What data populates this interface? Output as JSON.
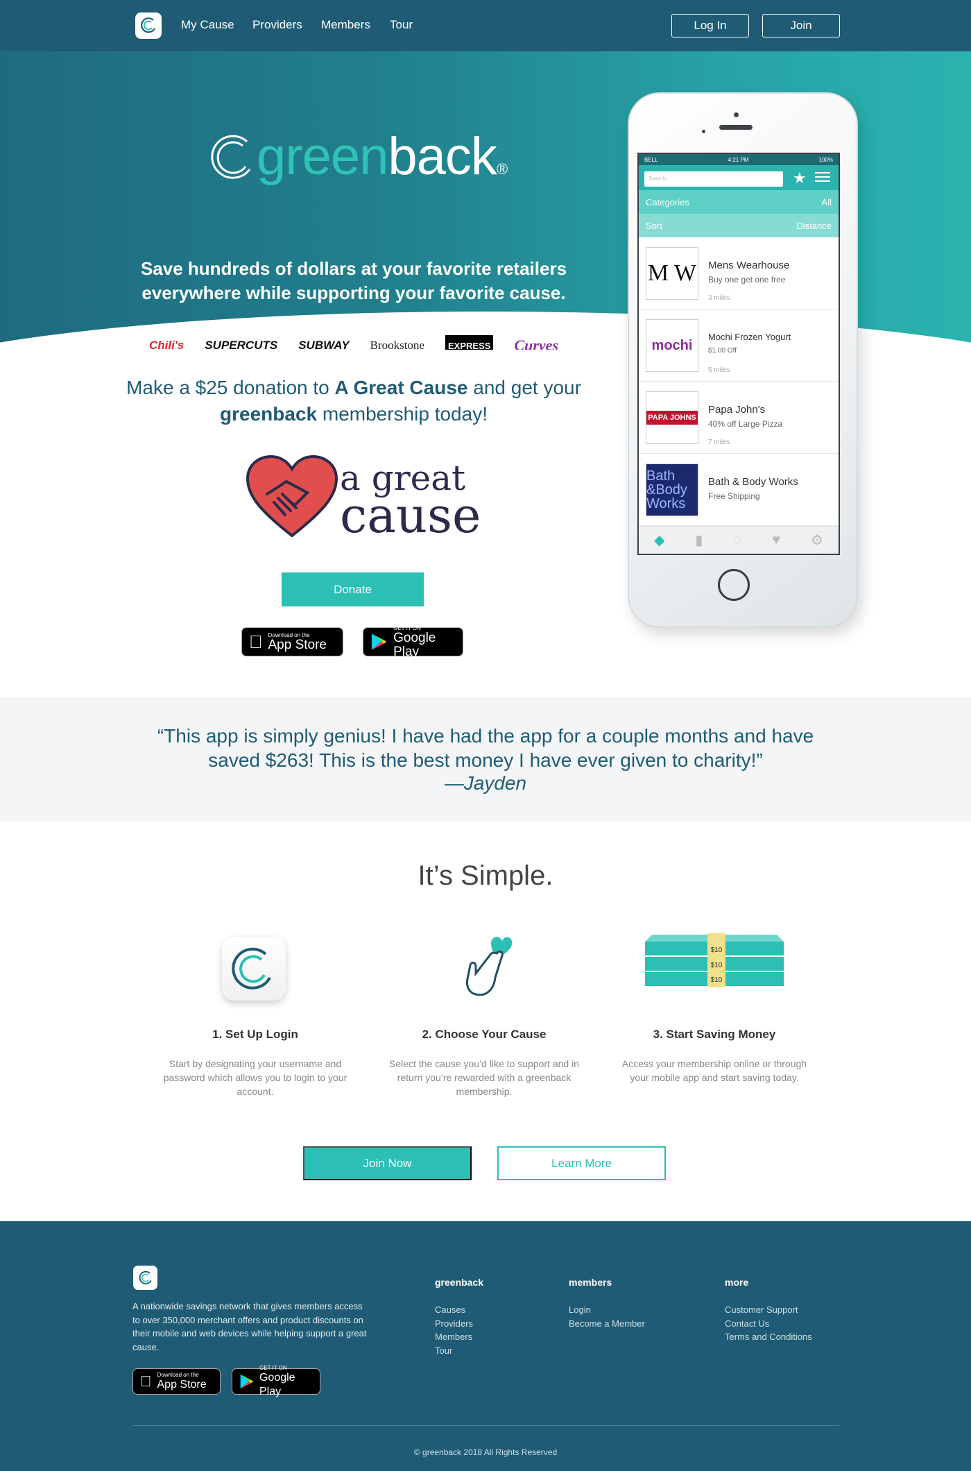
{
  "nav": {
    "links": [
      "My Cause",
      "Providers",
      "Members",
      "Tour"
    ],
    "login_label": "Log In",
    "join_label": "Join"
  },
  "hero": {
    "brand_part1": "green",
    "brand_part2": "back",
    "brand_mark": "®",
    "tagline": "Save hundreds of dollars at your favorite retailers everywhere while supporting your favorite cause.",
    "retailers": [
      "Chili's",
      "SUPERCUTS",
      "SUBWAY",
      "Brookstone",
      "EXPRESS",
      "Curves"
    ]
  },
  "phone": {
    "status_left": "BELL",
    "status_time": "4:21 PM",
    "status_right": "100%",
    "search_placeholder": "Search",
    "categories_label": "Categories",
    "categories_value": "All",
    "sort_label": "Sort",
    "sort_value": "Distance",
    "listings": [
      {
        "name": "Mens Wearhouse",
        "offer": "Buy one get one free",
        "distance": "3 miles"
      },
      {
        "name": "Mochi Frozen Yogurt",
        "offer": "$1.00 Off",
        "distance": "5 miles"
      },
      {
        "name": "Papa John's",
        "offer": "40% off Large Pizza",
        "distance": "7 miles"
      },
      {
        "name": "Bath & Body Works",
        "offer": "Free Shipping",
        "distance": ""
      }
    ],
    "thumb_text": {
      "mens": "M W",
      "mochi": "mochi",
      "papa": "PAPA JOHNS",
      "bath": "Bath &Body Works"
    }
  },
  "donation": {
    "text_pre": "Make a $25 donation to ",
    "cause_name": "A Great Cause",
    "text_mid": " and get your ",
    "brand": "greenback",
    "text_post": " membership today!",
    "cause_logo_line1": "a great",
    "cause_logo_line2": "cause",
    "donate_label": "Donate"
  },
  "badges": {
    "appstore_small": "Download on the",
    "appstore_big": "App Store",
    "googleplay_small": "GET IT ON",
    "googleplay_big": "Google Play"
  },
  "testimonial": {
    "quote": "“This app is simply genius! I have had the app for a couple months and have saved $263! This is the best money I have ever given to charity!”",
    "author": "—Jayden"
  },
  "simple": {
    "title": "It’s Simple.",
    "steps": [
      {
        "title": "1. Set Up Login",
        "desc": "Start by designating your username and password which allows you to login to your account."
      },
      {
        "title": "2. Choose Your Cause",
        "desc": "Select the cause you’d like to support and in return you’re rewarded with a greenback membership."
      },
      {
        "title": "3. Start Saving Money",
        "desc": "Access your membership online or through your mobile app and start saving today."
      }
    ],
    "money_label": "$10",
    "join_label": "Join Now",
    "learn_label": "Learn More"
  },
  "footer": {
    "description": "A nationwide savings network that gives members access to over 350,000 merchant offers and product discounts on their mobile and web devices while helping support a great cause.",
    "columns": [
      {
        "heading": "greenback",
        "links": [
          "Causes",
          "Providers",
          "Members",
          "Tour"
        ]
      },
      {
        "heading": "members",
        "links": [
          "Login",
          "Become a Member"
        ]
      },
      {
        "heading": "more",
        "links": [
          "Customer Support",
          "Contact Us",
          "Terms and Conditions"
        ]
      }
    ],
    "copyright": "© greenback 2018 All Rights Reserved"
  },
  "colors": {
    "nav": "#1f5b74",
    "accent": "#2bbfb5",
    "hero_start": "#1f6a80",
    "hero_end": "#2bb3af",
    "heart": "#e04e4e"
  }
}
